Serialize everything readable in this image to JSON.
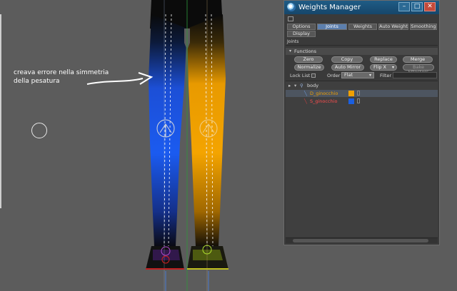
{
  "annotation": {
    "line1": "creava errore nella simmetria",
    "line2": "della pesatura"
  },
  "colors": {
    "left_leg_weight": "#1b4fd8",
    "right_leg_weight": "#f0a000",
    "viewport_bg": "#5c5c5c",
    "title_bar": "#1f5c86",
    "active_tab": "#5c7fae"
  },
  "window": {
    "title": "Weights Manager",
    "icon": "cinema4d-logo-icon",
    "controls": {
      "minimize": "–",
      "maximize": "□",
      "close": "✕"
    }
  },
  "tabs": [
    {
      "label": "Options",
      "active": false
    },
    {
      "label": "Joints",
      "active": true
    },
    {
      "label": "Weights",
      "active": false
    },
    {
      "label": "Auto Weight",
      "active": false
    },
    {
      "label": "Smoothing",
      "active": false
    },
    {
      "label": "Display",
      "active": false
    }
  ],
  "section_label": "Joints",
  "functions": {
    "header": "Functions",
    "row1": [
      "Zero",
      "Copy",
      "Replace",
      "Merge"
    ],
    "row2": {
      "normalize": "Normalize",
      "auto_mirror": "Auto Mirror",
      "flip": "Flip X",
      "bake": "Bake Effectors"
    }
  },
  "options_row": {
    "lock_list_label": "Lock List",
    "order_label": "Order",
    "order_value": "Flat",
    "filter_label": "Filter",
    "filter_value": ""
  },
  "tree": {
    "root": {
      "name": "body",
      "icon": "joint-root-icon"
    },
    "items": [
      {
        "name": "D_ginocchio",
        "color": "#f0a000",
        "text_color": "#f0a000"
      },
      {
        "name": "S_ginocchio",
        "color": "#1b5fe0",
        "text_color": "#ff4d4d"
      }
    ]
  }
}
